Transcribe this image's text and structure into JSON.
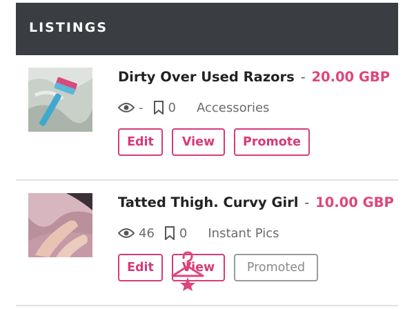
{
  "header": {
    "title": "LISTINGS"
  },
  "listings": [
    {
      "title": "Dirty Over Used Razors",
      "separator": "-",
      "price": "20.00 GBP",
      "views": "-",
      "saves": "0",
      "category": "Accessories",
      "buttons": {
        "edit": "Edit",
        "view": "View",
        "promote": "Promote"
      }
    },
    {
      "title": "Tatted Thigh. Curvy Girl",
      "separator": "-",
      "price": "10.00 GBP",
      "views": "46",
      "saves": "0",
      "category": "Instant Pics",
      "buttons": {
        "edit": "Edit",
        "view": "View",
        "promote": "Promoted"
      }
    }
  ],
  "icons": {
    "views": "eye-icon",
    "saves": "bookmark-icon",
    "overlay": "hanger-icon"
  },
  "colors": {
    "header_bg": "#3a3d42",
    "accent": "#d63a78",
    "price": "#e0457a",
    "disabled": "#9a9a9a"
  }
}
